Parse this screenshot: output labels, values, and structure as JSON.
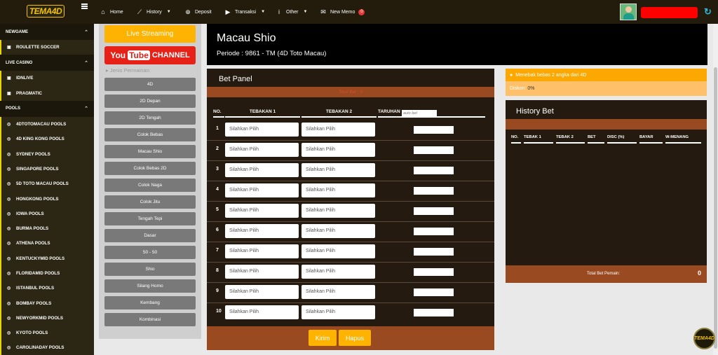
{
  "app": {
    "logo": "TEMA4D"
  },
  "nav": [
    {
      "label": "Home",
      "icon": "home-icon",
      "caret": false
    },
    {
      "label": "History",
      "icon": "chart-icon",
      "caret": true
    },
    {
      "label": "Deposit",
      "icon": "plus-circle-icon",
      "caret": false
    },
    {
      "label": "Transaksi",
      "icon": "play-icon",
      "caret": true
    },
    {
      "label": "Other",
      "icon": "info-icon",
      "caret": true
    },
    {
      "label": "New Memo",
      "icon": "mail-icon",
      "caret": false,
      "badge": "0"
    }
  ],
  "sidebar": {
    "sections": [
      {
        "title": "NEWGAME",
        "items": [
          "ROULETTE SOCCER"
        ]
      },
      {
        "title": "LIVE CASINO",
        "items": [
          "IDNLIVE",
          "PRAGMATIC"
        ]
      },
      {
        "title": "POOLS",
        "items": [
          "4DTOTOMACAU POOLS",
          "4D KING KONG POOLS",
          "SYDNEY POOLS",
          "SINGAPORE POOLS",
          "5D TOTO MACAU POOLS",
          "HONGKONG POOLS",
          "IOWA POOLS",
          "BURMA POOLS",
          "ATHENA POOLS",
          "KENTUCKYMID POOLS",
          "FLORIDAMID POOLS",
          "ISTANBUL POOLS",
          "BOMBAY POOLS",
          "NEWYORKMID POOLS",
          "KYOTO POOLS",
          "CAROLINADAY POOLS"
        ]
      }
    ]
  },
  "left": {
    "live": "Live Streaming",
    "youtube": {
      "you": "You",
      "tube": "Tube",
      "channel": "CHANNEL"
    },
    "jenis_label": "Jenis Permainan:",
    "games": [
      "4D",
      "2D Depan",
      "2D Tengah",
      "Colok Bebas",
      "Macau Shio",
      "Colok Bebas 2D",
      "Colok Naga",
      "Colok Jitu",
      "Tengah Tepi",
      "Dasar",
      "50 - 50",
      "Shio",
      "Silang Homo",
      "Kembang",
      "Kombinasi"
    ]
  },
  "header": {
    "title": "Macau Shio",
    "periode": "Periode : 9861 - TM (4D Toto Macau)"
  },
  "bet": {
    "title": "Bet Panel",
    "total": "Total Bet : 0",
    "col_no": "NO.",
    "col_t1": "TEBAKAN 1",
    "col_t2": "TEBAKAN 2",
    "col_taruhan": "TARUHAN",
    "auto_bet": "auto bet",
    "rows": [
      "1",
      "2",
      "3",
      "4",
      "5",
      "6",
      "7",
      "8",
      "9",
      "10"
    ],
    "select_placeholder": "Silahkan Pilih",
    "kirim": "Kirim",
    "hapus": "Hapus"
  },
  "info": {
    "note": "Menebak bebas 2 angka dari 4D",
    "diskon_label": "Diskon:",
    "diskon_value": "0%"
  },
  "history": {
    "title": "History Bet",
    "cols": [
      "NO.",
      "TEBAK 1",
      "TEBAK 2",
      "BET",
      "DISC (%)",
      "BAYAR",
      "W-MENANG"
    ],
    "total_label": "Total Bet Pemain:",
    "total_value": "0"
  },
  "colors": {
    "accent": "#fdb300",
    "brown": "#9a4a21",
    "dark": "#241a0f"
  }
}
